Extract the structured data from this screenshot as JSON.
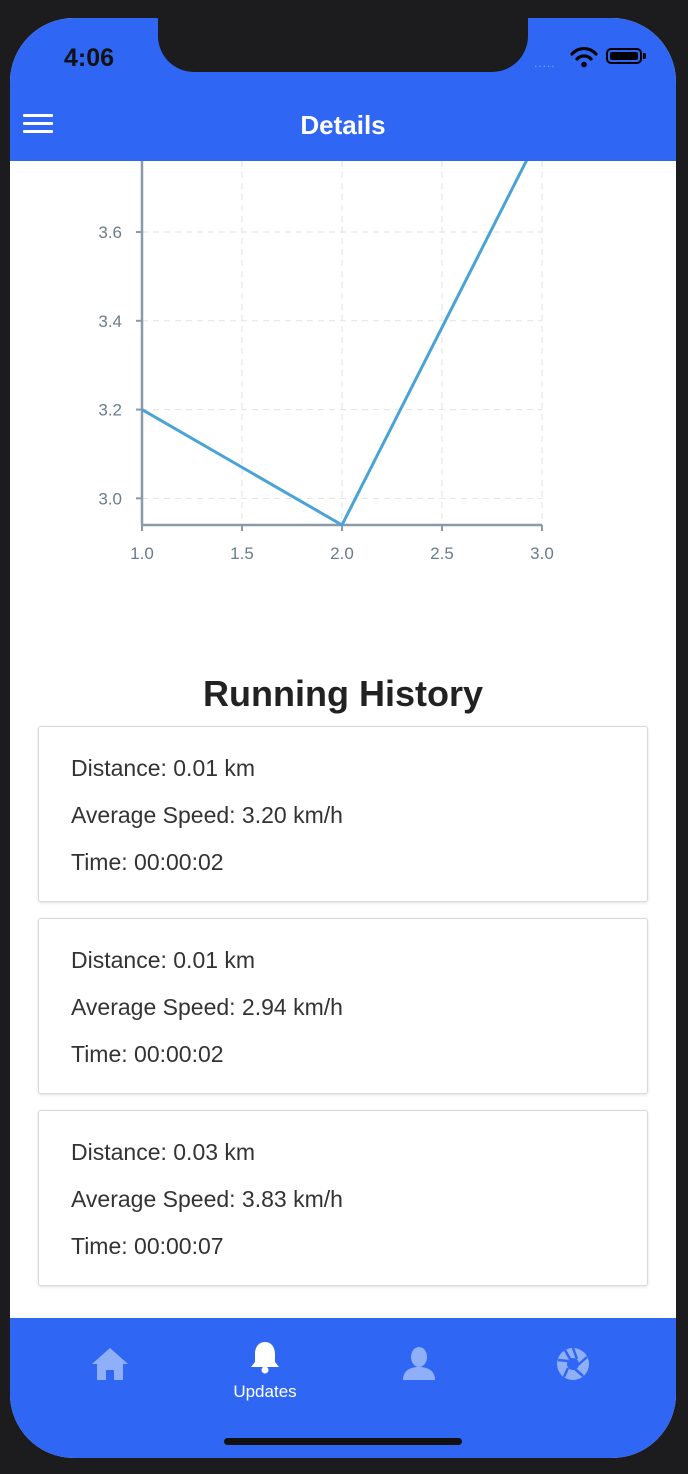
{
  "status_bar": {
    "time": "4:06",
    "signal": "....."
  },
  "header": {
    "title": "Details"
  },
  "chart_data": {
    "type": "line",
    "x": [
      1.0,
      2.0,
      3.0
    ],
    "series": [
      {
        "values": [
          3.2,
          2.94,
          3.83
        ]
      }
    ],
    "x_ticks": [
      "1.0",
      "1.5",
      "2.0",
      "2.5",
      "3.0"
    ],
    "y_ticks": [
      "3.0",
      "3.2",
      "3.4",
      "3.6"
    ],
    "xlim": [
      1.0,
      3.0
    ],
    "ylim_visible": [
      2.94,
      3.76
    ],
    "grid": true,
    "line_color": "#4aa3d6",
    "axis_color": "#8a9aa8"
  },
  "history": {
    "title": "Running History",
    "entries": [
      {
        "distance": "Distance: 0.01 km",
        "speed": "Average Speed: 3.20 km/h",
        "time": "Time: 00:00:02"
      },
      {
        "distance": "Distance: 0.01 km",
        "speed": "Average Speed: 2.94 km/h",
        "time": "Time: 00:00:02"
      },
      {
        "distance": "Distance: 0.03 km",
        "speed": "Average Speed: 3.83 km/h",
        "time": "Time: 00:00:07"
      }
    ]
  },
  "tabbar": {
    "tabs": [
      {
        "icon": "home-icon",
        "label": ""
      },
      {
        "icon": "bell-icon",
        "label": "Updates",
        "active": true
      },
      {
        "icon": "person-icon",
        "label": ""
      },
      {
        "icon": "aperture-icon",
        "label": ""
      }
    ]
  },
  "colors": {
    "brand": "#2f66f4",
    "inactive_icon": "#8fb0f8",
    "active_icon": "#ffffff"
  }
}
